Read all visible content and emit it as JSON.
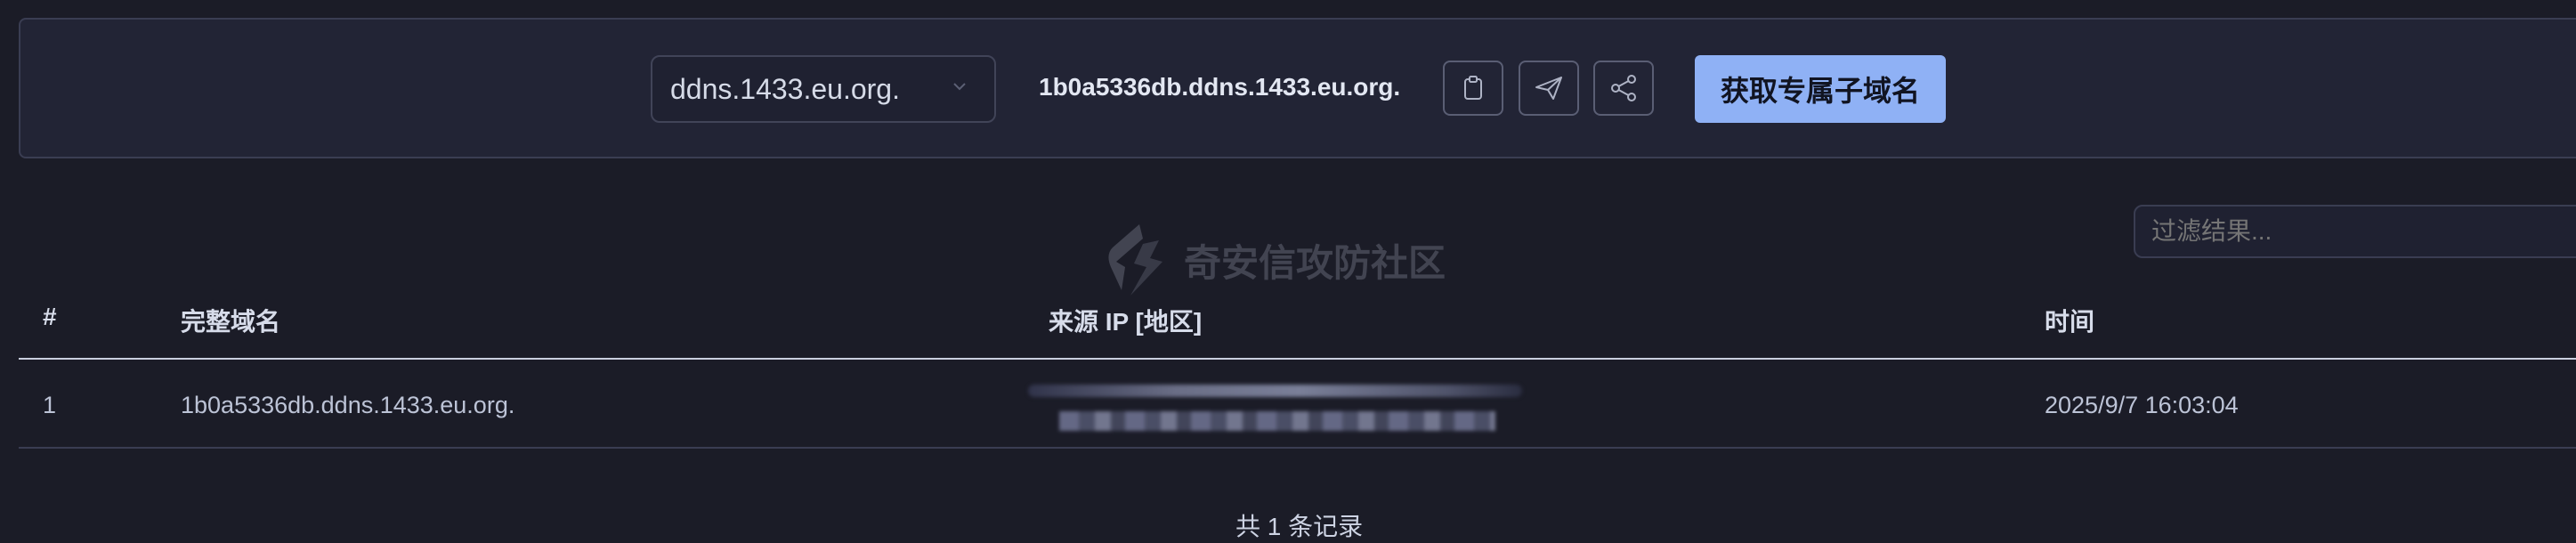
{
  "toolbar": {
    "domain_select": "ddns.1433.eu.org.",
    "subdomain": "1b0a5336db.ddns.1433.eu.org.",
    "copy_icon": "clipboard-icon",
    "send_icon": "send-icon",
    "share_icon": "share-icon",
    "primary_button": "获取专属子域名"
  },
  "filter": {
    "placeholder": "过滤结果..."
  },
  "watermark": {
    "text": "奇安信攻防社区"
  },
  "table": {
    "columns": [
      "#",
      "完整域名",
      "来源 IP [地区]",
      "时间"
    ],
    "rows": [
      {
        "index": "1",
        "domain": "1b0a5336db.ddns.1433.eu.org.",
        "time": "2025/9/7 16:03:04"
      }
    ]
  },
  "footer": {
    "count_text": "共 1 条记录"
  },
  "colors": {
    "accent": "#8fb1f5",
    "background": "#1b1c27",
    "panel": "#222435"
  }
}
